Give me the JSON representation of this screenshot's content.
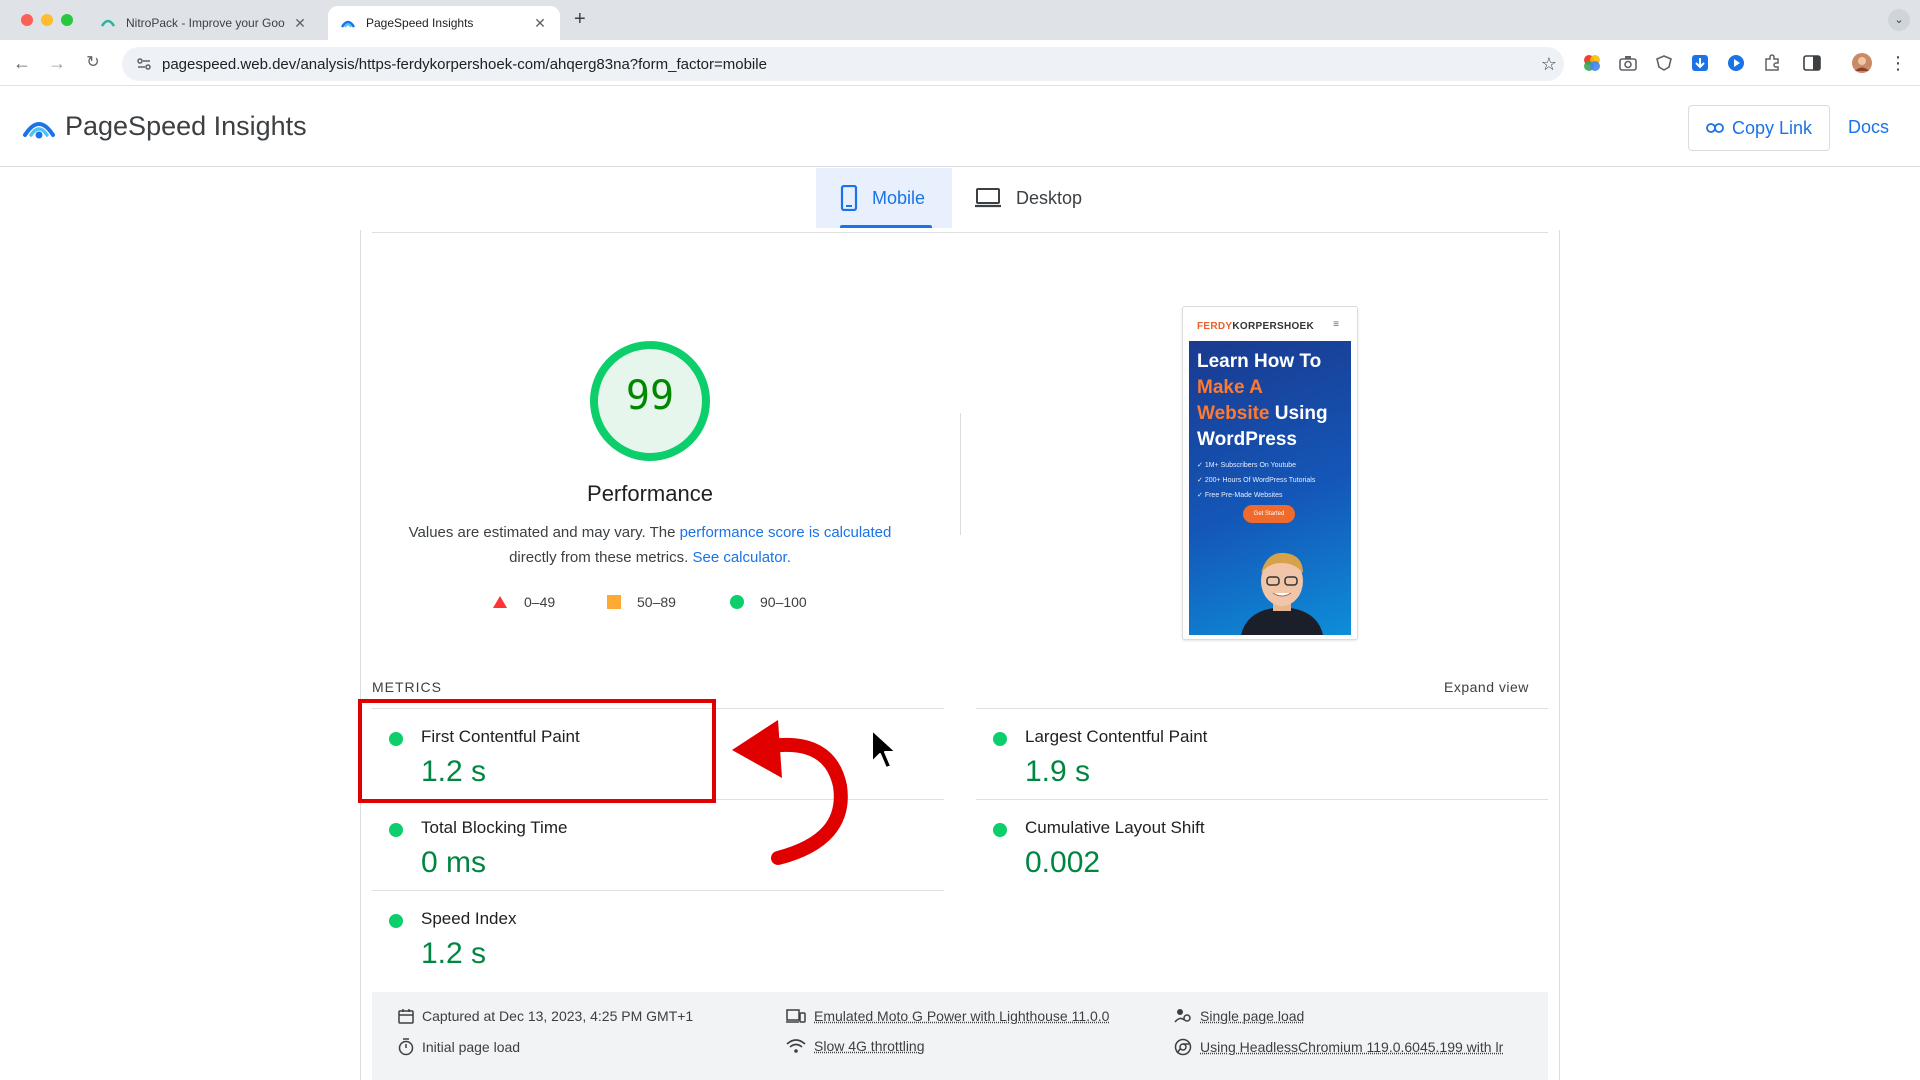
{
  "browser": {
    "tabs": [
      {
        "title": "NitroPack - Improve your Goo",
        "active": false
      },
      {
        "title": "PageSpeed Insights",
        "active": true
      }
    ],
    "new_tab": "+",
    "url": "pagespeed.web.dev/analysis/https-ferdykorpershoek-com/ahqerg83na?form_factor=mobile"
  },
  "header": {
    "title": "PageSpeed Insights",
    "copy_link": "Copy Link",
    "docs": "Docs"
  },
  "device_tabs": {
    "mobile": "Mobile",
    "desktop": "Desktop",
    "selected": "mobile"
  },
  "score": {
    "value": 99,
    "value_label": "99",
    "title": "Performance",
    "desc_prefix": "Values are estimated and may vary. The ",
    "desc_link1": "performance score is calculated",
    "desc_mid": " directly from these metrics. ",
    "desc_link2": "See calculator.",
    "legend": [
      {
        "range": "0–49",
        "shape": "triangle",
        "color": "#ff3333"
      },
      {
        "range": "50–89",
        "shape": "square",
        "color": "#ffaa33"
      },
      {
        "range": "90–100",
        "shape": "circle",
        "color": "#0cce6b"
      }
    ],
    "ring_color": "#0cce6b",
    "ring_bg": "#e6f6ed"
  },
  "screenshot": {
    "brand_a": "FERDY",
    "brand_b": "KORPERSHOEK",
    "menu": "≡",
    "headline_1": "Learn How To",
    "headline_2": "Make A",
    "headline_3": "Website",
    "headline_4": " Using",
    "headline_5": "WordPress",
    "bullets": [
      "1M+ Subscribers On Youtube",
      "200+ Hours Of WordPress Tutorials",
      "Free Pre-Made Websites"
    ],
    "cta": "Get Started"
  },
  "metrics": {
    "label": "METRICS",
    "expand": "Expand view",
    "items": [
      {
        "name": "First Contentful Paint",
        "value": "1.2 s"
      },
      {
        "name": "Largest Contentful Paint",
        "value": "1.9 s"
      },
      {
        "name": "Total Blocking Time",
        "value": "0 ms"
      },
      {
        "name": "Cumulative Layout Shift",
        "value": "0.002"
      },
      {
        "name": "Speed Index",
        "value": "1.2 s"
      }
    ],
    "good_color": "#0cce6b"
  },
  "footer": {
    "captured": "Captured at Dec 13, 2023, 4:25 PM GMT+1",
    "initial_load": "Initial page load",
    "emulated": "Emulated Moto G Power with Lighthouse 11.0.0",
    "throttling": "Slow 4G throttling",
    "single_load": "Single page load",
    "using": "Using HeadlessChromium 119.0.6045.199 with lr"
  },
  "annotation": {
    "highlight_color": "#e00000"
  }
}
